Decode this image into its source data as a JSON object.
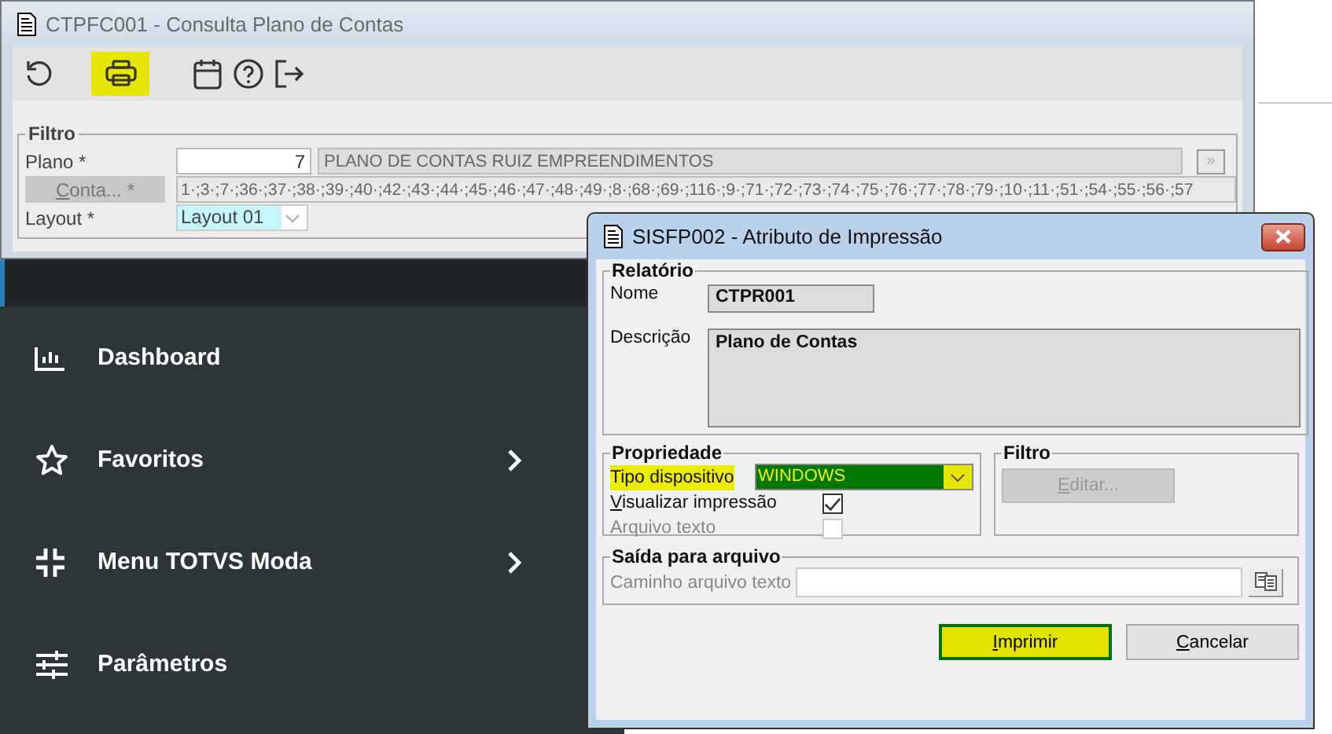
{
  "sidebar": {
    "items": [
      {
        "label": "Dashboard",
        "has_submenu": false
      },
      {
        "label": "Favoritos",
        "has_submenu": true
      },
      {
        "label": "Menu TOTVS Moda",
        "has_submenu": true
      },
      {
        "label": "Parâmetros",
        "has_submenu": false
      }
    ]
  },
  "main_window": {
    "title": "CTPFC001 - Consulta Plano de Contas",
    "toolbar": [
      {
        "highlighted": false
      },
      {
        "highlighted": true
      },
      {
        "highlighted": false
      },
      {
        "highlighted": false
      },
      {
        "highlighted": false
      }
    ],
    "filter": {
      "title": "Filtro",
      "plano": {
        "label": "Plano *",
        "code": "7",
        "description": "PLANO DE CONTAS RUIZ EMPREENDIMENTOS",
        "lookup_button": "»"
      },
      "conta": {
        "button": "Conta... *",
        "value": "1·;3·;7·;36·;37·;38·;39·;40·;42·;43·;44·;45·;46·;47·;48·;49·;8·;68·;69·;116·;9·;71·;72·;73·;74·;75·;76·;77·;78·;79·;10·;11·;51·;54·;55·;56·;57"
      },
      "layout": {
        "label": "Layout *",
        "value": "Layout 01"
      }
    }
  },
  "dialog": {
    "title": "SISFP002 - Atributo de Impressão",
    "report": {
      "title": "Relatório",
      "name_label": "Nome",
      "name": "CTPR001",
      "description_label": "Descrição",
      "description": "Plano de Contas"
    },
    "properties": {
      "title": "Propriedade",
      "device": {
        "label": "Tipo dispositivo",
        "value": "WINDOWS",
        "highlighted": true
      },
      "options": [
        {
          "label": "Visualizar impressão",
          "checked": true,
          "disabled": false
        },
        {
          "label": "Arquivo texto",
          "checked": false,
          "disabled": true
        }
      ]
    },
    "filter": {
      "title": "Filtro",
      "button": "Editar...",
      "disabled": true
    },
    "output": {
      "title": "Saída para arquivo",
      "label": "Caminho arquivo texto",
      "disabled": true
    },
    "buttons": [
      {
        "label": "Imprimir",
        "highlighted": true
      },
      {
        "label": "Cancelar",
        "highlighted": false
      }
    ]
  }
}
